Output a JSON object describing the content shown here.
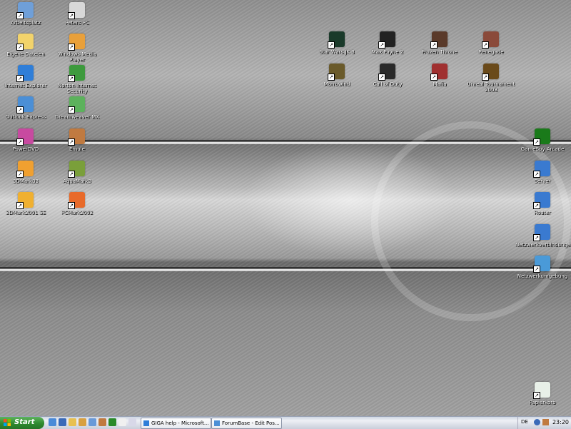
{
  "desktop": {
    "icons_left": [
      {
        "name": "arbeitsplatz-icon",
        "label": "Arbeitsplatz",
        "color": "#6f9fd8"
      },
      {
        "name": "peters-pc-icon",
        "label": "Peters PC",
        "color": "#d8d8d8"
      },
      {
        "name": "eigene-dateien-icon",
        "label": "Eigene Dateien",
        "color": "#f2d36b"
      },
      {
        "name": "windows-media-player-icon",
        "label": "Windows Media Player",
        "color": "#e9a03a"
      },
      {
        "name": "internet-explorer-icon",
        "label": "Internet Explorer",
        "color": "#2f7ed8"
      },
      {
        "name": "norton-internet-security-icon",
        "label": "Norton Internet Security",
        "color": "#3d9a3d"
      },
      {
        "name": "outlook-express-icon",
        "label": "Outlook Express",
        "color": "#4b8fd6"
      },
      {
        "name": "dreamweaver-mx-icon",
        "label": "Dreamweaver MX",
        "color": "#5cb25c"
      },
      {
        "name": "powerdvd-icon",
        "label": "PowerDVD",
        "color": "#c84aa0"
      },
      {
        "name": "emule-icon",
        "label": "Emule",
        "color": "#c07a40"
      },
      {
        "name": "3dmark03-icon",
        "label": "3DMark03",
        "color": "#f0a030"
      },
      {
        "name": "aquamark3-icon",
        "label": "AquaMark3",
        "color": "#7a9f3a"
      },
      {
        "name": "3dmark2001se-icon",
        "label": "3DMark2001 SE",
        "color": "#f0b030"
      },
      {
        "name": "pcmark2002-icon",
        "label": "PCMark2002",
        "color": "#e86a2a"
      }
    ],
    "icons_games": [
      {
        "name": "star-wars-jk3-icon",
        "label": "Star Wars JK 3",
        "color": "#1a3a2a"
      },
      {
        "name": "max-payne-2-icon",
        "label": "Max Payne 2",
        "color": "#222222"
      },
      {
        "name": "frozen-throne-icon",
        "label": "Frozen Throne",
        "color": "#5a3a2a"
      },
      {
        "name": "renegade-icon",
        "label": "Renegade",
        "color": "#8a4a3a"
      },
      {
        "name": "morrowind-icon",
        "label": "Morrowind",
        "color": "#6a5a2a"
      },
      {
        "name": "call-of-duty-icon",
        "label": "Call of Duty",
        "color": "#2a2a2a"
      },
      {
        "name": "mafia-icon",
        "label": "Mafia",
        "color": "#a03030"
      },
      {
        "name": "unreal-tournament-2003-icon",
        "label": "Unreal Tournament 2003",
        "color": "#6a4a1a"
      }
    ],
    "icons_right": [
      {
        "name": "gamespy-arcade-icon",
        "label": "GameSpy Arcade",
        "color": "#1a7a1a"
      },
      {
        "name": "server-icon",
        "label": "Server",
        "color": "#3a7ad0"
      },
      {
        "name": "router-icon",
        "label": "Router",
        "color": "#3a7ad0"
      },
      {
        "name": "netzwerkverbindungen-icon",
        "label": "Netzwerkverbindungen",
        "color": "#3a7ad0"
      },
      {
        "name": "netzwerkumgebung-icon",
        "label": "Netzwerkumgebung",
        "color": "#4a9ad8"
      },
      {
        "name": "papierkorb-icon",
        "label": "Papierkorb",
        "color": "#e8f0e8"
      }
    ]
  },
  "taskbar": {
    "start_label": "Start",
    "tasks": [
      {
        "label": "GIGA help - Microsoft...",
        "color": "#2f7ed8"
      },
      {
        "label": "ForumBase - Edit Pos...",
        "color": "#4b8fd6"
      }
    ],
    "lang": "DE",
    "time": "23:20"
  }
}
